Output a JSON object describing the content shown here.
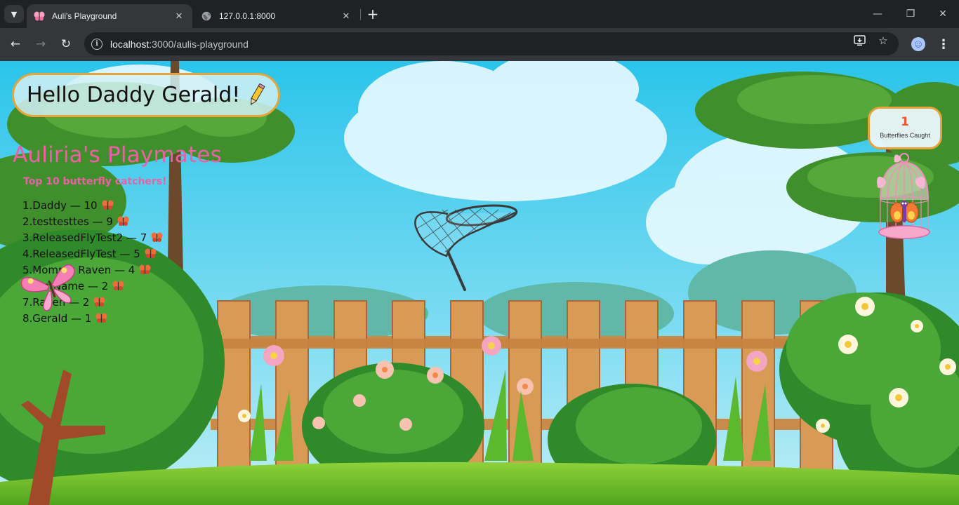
{
  "browser": {
    "tabs": [
      {
        "title": "Auli's Playground",
        "active": true,
        "icon": "butterfly-favicon"
      },
      {
        "title": "127.0.0.1:8000",
        "active": false,
        "icon": "globe-icon"
      }
    ],
    "url": {
      "host": "localhost",
      "rest": ":3000/aulis-playground"
    }
  },
  "page": {
    "greeting": "Hello Daddy Gerald!",
    "greeting_icon": "pencil-icon",
    "playmates_title": "Auliria's Playmates",
    "playmates_subtitle": "Top 10 butterfly catchers!",
    "leaderboard": [
      {
        "text": "1.Daddy — 10"
      },
      {
        "text": "2.testtesttes — 9"
      },
      {
        "text": "3.ReleasedFlyTest2 — 7"
      },
      {
        "text": "4.ReleasedFlyTest — 5"
      },
      {
        "text": "5.Mommy Raven — 4"
      },
      {
        "text": "6.TestName — 2"
      },
      {
        "text": "7.Raven — 2"
      },
      {
        "text": "8.Gerald — 1"
      }
    ],
    "counter": {
      "value": "1",
      "label": "Butterflies Caught"
    }
  },
  "colors": {
    "accent_pink": "#ef5fa5",
    "border_orange": "#e6a43a",
    "counter_number": "#f05a28"
  }
}
